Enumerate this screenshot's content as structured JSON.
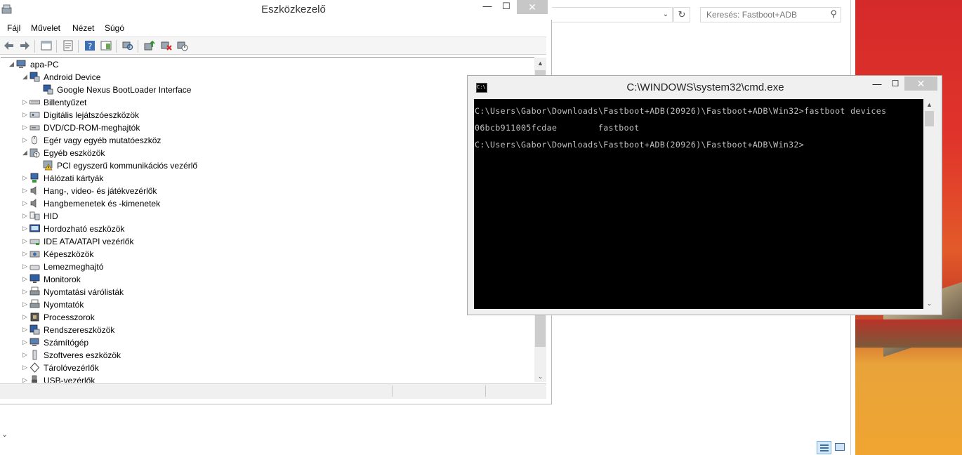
{
  "explorer": {
    "search_placeholder": "Keresés: Fastboot+ADB"
  },
  "device_manager": {
    "title": "Eszközkezelő",
    "menu": [
      "Fájl",
      "Művelet",
      "Nézet",
      "Súgó"
    ],
    "tree": [
      {
        "label": "apa-PC",
        "level": 0,
        "state": "expanded",
        "icon": "computer-icon"
      },
      {
        "label": "Android Device",
        "level": 1,
        "state": "expanded",
        "icon": "android-device-icon"
      },
      {
        "label": "Google Nexus BootLoader Interface",
        "level": 2,
        "state": "leaf",
        "icon": "android-device-icon"
      },
      {
        "label": "Billentyűzet",
        "level": 1,
        "state": "collapsed",
        "icon": "keyboard-icon"
      },
      {
        "label": "Digitális lejátszóeszközök",
        "level": 1,
        "state": "collapsed",
        "icon": "media-player-icon"
      },
      {
        "label": "DVD/CD-ROM-meghajtók",
        "level": 1,
        "state": "collapsed",
        "icon": "dvd-drive-icon"
      },
      {
        "label": "Egér vagy egyéb mutatóeszköz",
        "level": 1,
        "state": "collapsed",
        "icon": "mouse-icon"
      },
      {
        "label": "Egyéb eszközök",
        "level": 1,
        "state": "expanded",
        "icon": "unknown-device-icon"
      },
      {
        "label": "PCI egyszerű kommunikációs vezérlő",
        "level": 2,
        "state": "leaf",
        "icon": "warning-device-icon"
      },
      {
        "label": "Hálózati kártyák",
        "level": 1,
        "state": "collapsed",
        "icon": "network-adapter-icon"
      },
      {
        "label": "Hang-, video- és játékvezérlők",
        "level": 1,
        "state": "collapsed",
        "icon": "speaker-icon"
      },
      {
        "label": "Hangbemenetek és -kimenetek",
        "level": 1,
        "state": "collapsed",
        "icon": "speaker-icon"
      },
      {
        "label": "HID",
        "level": 1,
        "state": "collapsed",
        "icon": "hid-icon"
      },
      {
        "label": "Hordozható eszközök",
        "level": 1,
        "state": "collapsed",
        "icon": "portable-device-icon"
      },
      {
        "label": "IDE ATA/ATAPI vezérlők",
        "level": 1,
        "state": "collapsed",
        "icon": "ide-controller-icon"
      },
      {
        "label": "Képeszközök",
        "level": 1,
        "state": "collapsed",
        "icon": "imaging-device-icon"
      },
      {
        "label": "Lemezmeghajtó",
        "level": 1,
        "state": "collapsed",
        "icon": "disk-drive-icon"
      },
      {
        "label": "Monitorok",
        "level": 1,
        "state": "collapsed",
        "icon": "monitor-icon"
      },
      {
        "label": "Nyomtatási várólisták",
        "level": 1,
        "state": "collapsed",
        "icon": "printer-icon"
      },
      {
        "label": "Nyomtatók",
        "level": 1,
        "state": "collapsed",
        "icon": "printer-icon"
      },
      {
        "label": "Processzorok",
        "level": 1,
        "state": "collapsed",
        "icon": "processor-icon"
      },
      {
        "label": "Rendszereszközök",
        "level": 1,
        "state": "collapsed",
        "icon": "system-device-icon"
      },
      {
        "label": "Számítógép",
        "level": 1,
        "state": "collapsed",
        "icon": "computer-icon"
      },
      {
        "label": "Szoftveres eszközök",
        "level": 1,
        "state": "collapsed",
        "icon": "software-device-icon"
      },
      {
        "label": "Tárolóvezérlők",
        "level": 1,
        "state": "collapsed",
        "icon": "storage-controller-icon"
      },
      {
        "label": "USB-vezérlők",
        "level": 1,
        "state": "collapsed",
        "icon": "usb-icon"
      }
    ]
  },
  "cmd": {
    "title": "C:\\WINDOWS\\system32\\cmd.exe",
    "lines": [
      "C:\\Users\\Gabor\\Downloads\\Fastboot+ADB(20926)\\Fastboot+ADB\\Win32>fastboot devices",
      "06bcb911005fcdae        fastboot",
      "C:\\Users\\Gabor\\Downloads\\Fastboot+ADB(20926)\\Fastboot+ADB\\Win32>"
    ]
  },
  "colors": {
    "console_bg": "#000000",
    "console_text": "#c0c0c0",
    "close_button": "#c7c7c7",
    "wallpaper": "#e0332b"
  }
}
